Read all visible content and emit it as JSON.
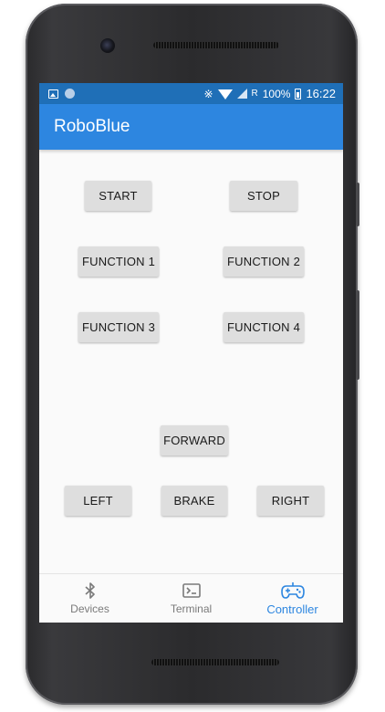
{
  "status_bar": {
    "bluetooth_icon": "bluetooth-icon",
    "vibrate_label": "R",
    "battery_percent": "100%",
    "time": "16:22"
  },
  "app_bar": {
    "title": "RoboBlue"
  },
  "controller": {
    "start": "START",
    "stop": "STOP",
    "function1": "FUNCTION 1",
    "function2": "FUNCTION 2",
    "function3": "FUNCTION 3",
    "function4": "FUNCTION 4",
    "forward": "FORWARD",
    "left": "LEFT",
    "brake": "BRAKE",
    "right": "RIGHT"
  },
  "bottom_nav": {
    "items": [
      {
        "label": "Devices",
        "icon": "bluetooth-icon"
      },
      {
        "label": "Terminal",
        "icon": "terminal-icon"
      },
      {
        "label": "Controller",
        "icon": "gamepad-icon",
        "active": true
      }
    ]
  },
  "colors": {
    "accent": "#2d86e0",
    "status_bar": "#1f6fb7",
    "button": "#dedede",
    "inactive_nav": "#7a7a7a"
  }
}
